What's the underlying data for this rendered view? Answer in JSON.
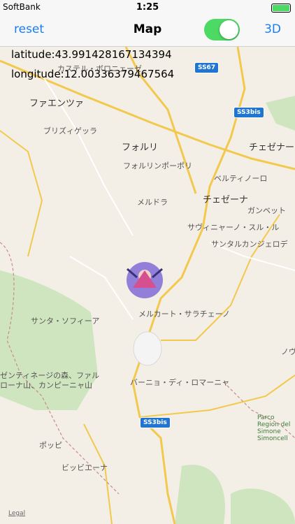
{
  "status": {
    "carrier": "SoftBank",
    "time": "1:25"
  },
  "nav": {
    "reset": "reset",
    "title": "Map",
    "toggle_on": true,
    "three_d": "3D"
  },
  "coords": {
    "latitude": "latitude:43.991428167134394",
    "longitude": "longitude:12.00336379467564"
  },
  "road_shields": {
    "ss67": "SS67",
    "ss3bis_top": "SS3bis",
    "ss3bis_bottom": "SS3bis"
  },
  "places": {
    "castel": "カステル・ボロニェーゼ",
    "faenza": "ファエンツァ",
    "brisighella": "ブリズィゲッラ",
    "forli": "フォルリ",
    "forlimpopoli": "フォルリンポーポリ",
    "bertinoro": "ベルティノーロ",
    "cesena_top": "チェゼナー",
    "meldola": "メルドラ",
    "cesena": "チェゼーナ",
    "gambettola": "ガンベット",
    "savignano": "サヴィニャーノ・スル・ル",
    "santarcangelo": "サンタルカンジェロデ",
    "mercato": "メルカート・サラチェーノ",
    "santa_sofia": "サンタ・ソフィーア",
    "novafeltria": "ノヴ",
    "park": "ゼンティネージの森、ファル",
    "park2": "ローナ山、カンピーニャ山",
    "bagno": "バーニョ・ディ・ロマーニャ",
    "poppi": "ポッピ",
    "bibbiena": "ビッビエーナ",
    "parco_right": "Parco Region del Simone Simoncell"
  },
  "legal": "Legal"
}
